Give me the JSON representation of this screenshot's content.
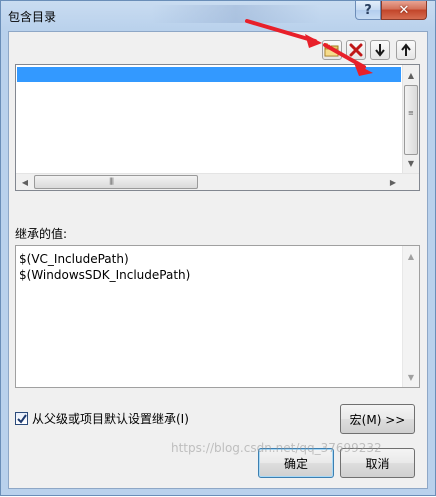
{
  "window": {
    "title": "包含目录",
    "help_glyph": "?",
    "close_glyph": "✕"
  },
  "toolbar": {
    "new_line_icon": "new-folder-icon",
    "delete_icon": "delete-icon",
    "move_down_icon": "arrow-down-icon",
    "move_up_icon": "arrow-up-icon"
  },
  "inherited": {
    "label": "继承的值:",
    "items": [
      "$(VC_IncludePath)",
      "$(WindowsSDK_IncludePath)"
    ]
  },
  "options": {
    "inherit_checkbox_label": "从父级或项目默认设置继承(I)",
    "inherit_checked": true
  },
  "buttons": {
    "macros": "宏(M) >>",
    "ok": "确定",
    "cancel": "取消"
  },
  "watermark": "https://blog.csdn.net/qq_37699232",
  "colors": {
    "selection": "#3399ff",
    "annotation_arrow": "#e8202a",
    "delete_x": "#c01818"
  }
}
